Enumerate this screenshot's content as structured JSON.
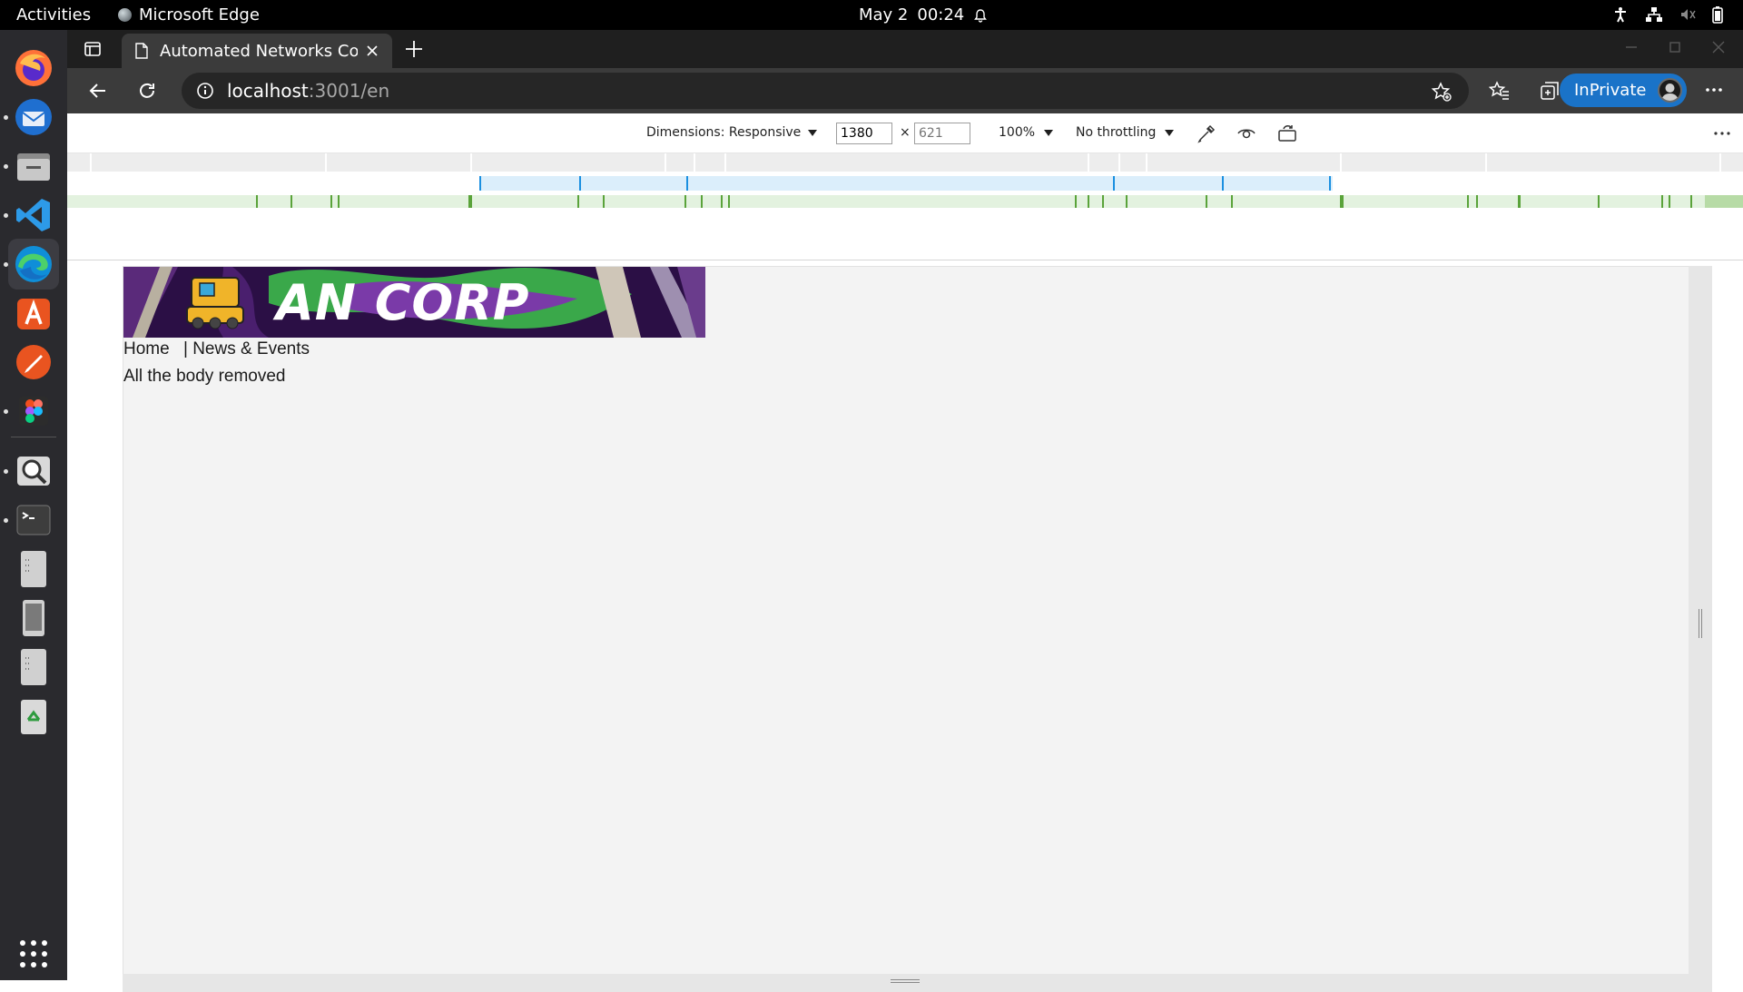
{
  "topbar": {
    "activities": "Activities",
    "app_name": "Microsoft Edge",
    "date": "May 2",
    "time": "00:24"
  },
  "dock": {
    "apps": [
      "firefox-icon",
      "thunderbird-icon",
      "files-icon",
      "vscode-icon",
      "edge-icon",
      "app-center-icon",
      "inkscape-icon",
      "figma-icon",
      "search-app-icon",
      "terminal-icon",
      "file-1-icon",
      "device-icon",
      "file-2-icon",
      "trash-icon",
      "app-grid-icon"
    ]
  },
  "browser": {
    "tab_title": "Automated Networks Corp",
    "url_host": "localhost",
    "url_rest": ":3001/en",
    "inprivate_label": "InPrivate"
  },
  "devtools": {
    "dimensions_label": "Dimensions: Responsive",
    "width_value": "1380",
    "height_placeholder": "621",
    "times": "×",
    "zoom": "100%",
    "throttling": "No throttling"
  },
  "page": {
    "logo_text": "AN CORP",
    "nav_home": "Home",
    "nav_separator": "|",
    "nav_news": "News & Events",
    "body_text": "All the body removed"
  }
}
